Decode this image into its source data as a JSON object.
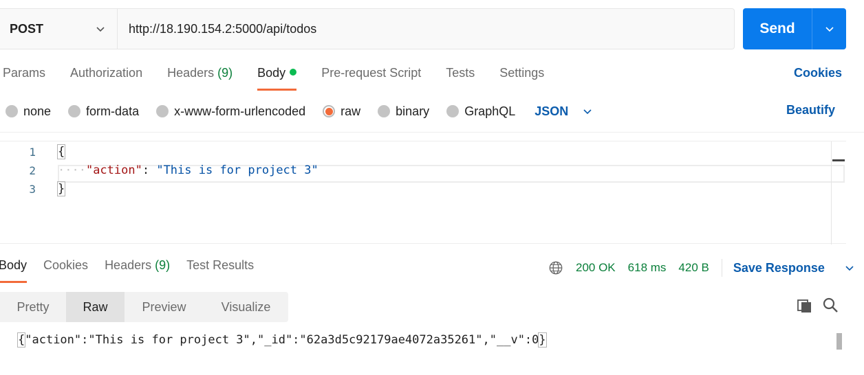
{
  "request": {
    "method": "POST",
    "url": "http://18.190.154.2:5000/api/todos",
    "send_label": "Send"
  },
  "request_tabs": [
    {
      "label": "Params"
    },
    {
      "label": "Authorization"
    },
    {
      "label": "Headers",
      "count": "(9)"
    },
    {
      "label": "Body",
      "active": true
    },
    {
      "label": "Pre-request Script"
    },
    {
      "label": "Tests"
    },
    {
      "label": "Settings"
    }
  ],
  "cookies_label": "Cookies",
  "body_options": {
    "items": [
      "none",
      "form-data",
      "x-www-form-urlencoded",
      "raw",
      "binary",
      "GraphQL"
    ],
    "selected": "raw",
    "format": "JSON",
    "beautify_label": "Beautify"
  },
  "editor": {
    "line_numbers": [
      "1",
      "2",
      "3"
    ],
    "open_brace": "{",
    "indent": "····",
    "key": "\"action\"",
    "colon": ": ",
    "value": "\"This is for project 3\"",
    "close_brace": "}"
  },
  "response_tabs": [
    {
      "label": "Body",
      "active": true
    },
    {
      "label": "Cookies"
    },
    {
      "label": "Headers",
      "count": "(9)"
    },
    {
      "label": "Test Results"
    }
  ],
  "response_meta": {
    "status": "200 OK",
    "time": "618 ms",
    "size": "420 B",
    "save_label": "Save Response"
  },
  "view_modes": [
    {
      "label": "Pretty"
    },
    {
      "label": "Raw",
      "active": true
    },
    {
      "label": "Preview"
    },
    {
      "label": "Visualize"
    }
  ],
  "response_body": {
    "open_brace": "{",
    "text": "\"action\":\"This is for project 3\",\"_id\":\"62a3d5c92179ae4072a35261\",\"__v\":0",
    "close_brace": "}"
  },
  "colors": {
    "accent": "#f26b3a",
    "send": "#097bed",
    "link": "#0b5cad",
    "status_green": "#0a7f3a"
  }
}
